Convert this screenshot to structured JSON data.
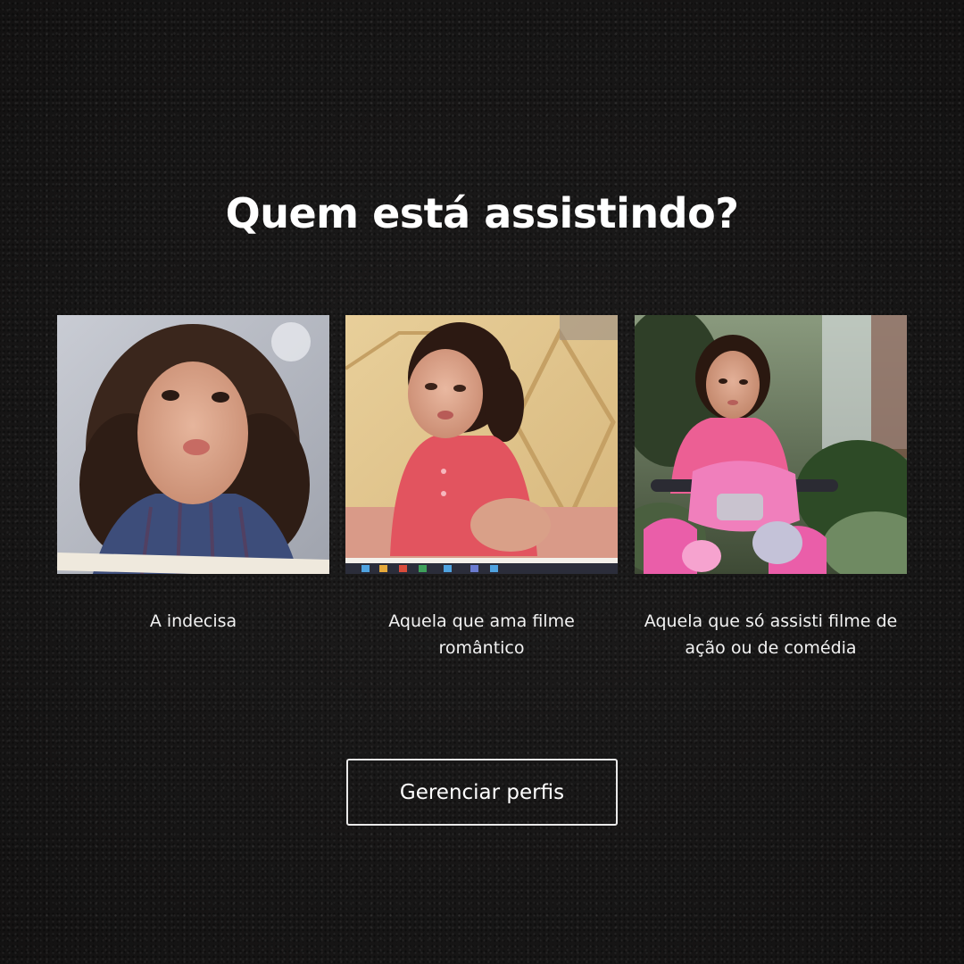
{
  "page": {
    "title": "Quem está assistindo?"
  },
  "profiles": [
    {
      "name": "A indecisa",
      "image": "profile-photo-girl-blowing-kiss"
    },
    {
      "name": "Aquela que ama filme romântico",
      "image": "profile-photo-girl-crying"
    },
    {
      "name": "Aquela que só assisti filme de ação ou de comédia",
      "image": "profile-photo-girl-on-pink-toy-motorcycle"
    }
  ],
  "actions": {
    "manage_profiles_label": "Gerenciar perfis"
  },
  "colors": {
    "background": "#141313",
    "text": "#ffffff",
    "button_border": "#e9e9e9"
  }
}
